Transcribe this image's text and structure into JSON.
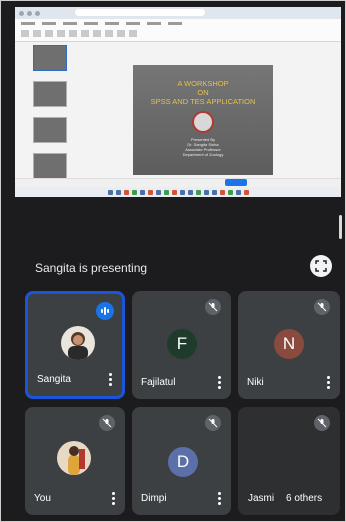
{
  "shared_screen": {
    "slide": {
      "title_line1": "A WORKSHOP",
      "title_line2": "ON",
      "title_line3": "SPSS AND TES APPLICATION",
      "presenter_line1": "Presented By",
      "presenter_line2": "Dr. Sangita Sinha",
      "presenter_line3": "Associate Professor",
      "presenter_line4": "Department of Zoology"
    }
  },
  "meeting": {
    "presenting_text": "Sangita is presenting",
    "fullscreen_icon": "fullscreen-icon"
  },
  "participants": [
    {
      "name": "Sangita",
      "avatar_type": "photo",
      "speaking": true
    },
    {
      "name": "Fajilatul",
      "initial": "F",
      "avatar_color": "#1f3b2c",
      "muted": true
    },
    {
      "name": "Niki",
      "initial": "N",
      "avatar_color": "#8a4a3e",
      "muted": true
    },
    {
      "name": "You",
      "avatar_type": "photo",
      "muted": true
    },
    {
      "name": "Dimpi",
      "initial": "D",
      "avatar_color": "#5b6fa8",
      "muted": true
    },
    {
      "name": "Jasmi",
      "muted": true
    }
  ],
  "others_label": "6 others",
  "colors": {
    "background": "#202124",
    "tile": "#3c4043",
    "active_border": "#1a56db",
    "speaking_indicator": "#1a73e8"
  }
}
